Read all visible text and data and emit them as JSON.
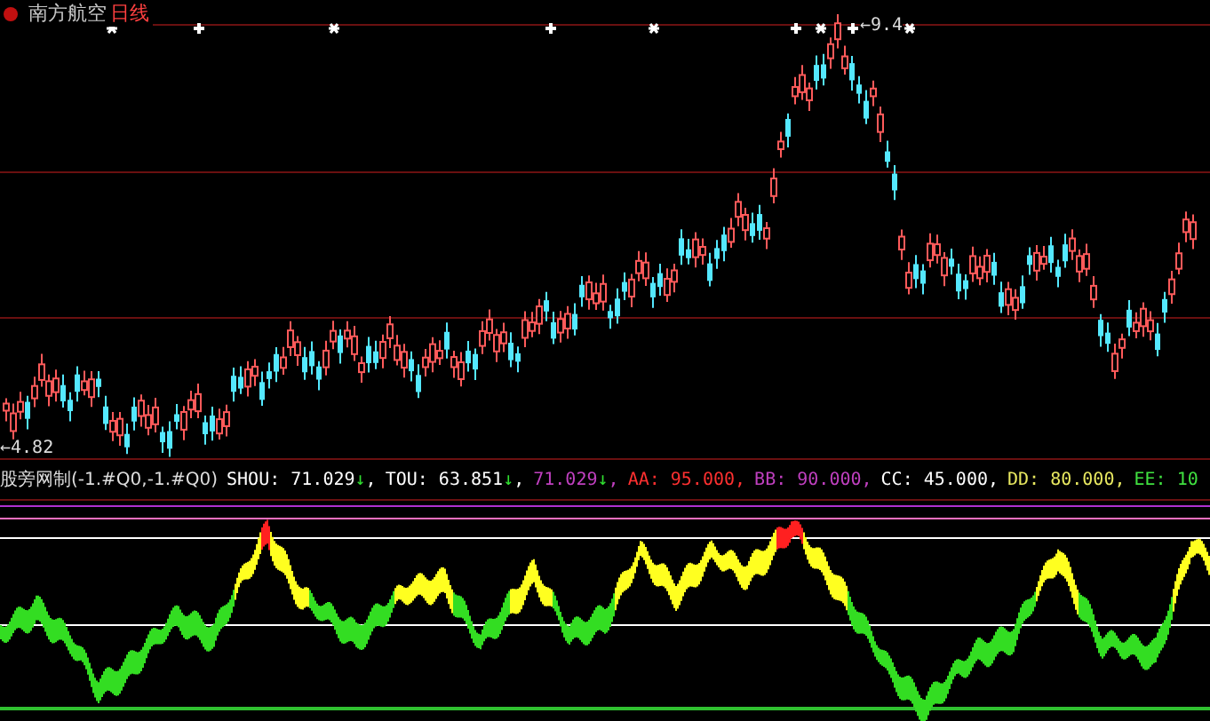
{
  "header": {
    "stock": "南方航空",
    "period": "日线"
  },
  "price_chart": {
    "peak_label": "←9.4",
    "low_label": "←4.82"
  },
  "indicator": {
    "name": "股旁网制(-1.#Q0,-1.#Q0)",
    "items": [
      {
        "text": "SHOU: 71.029",
        "arrow": "↓",
        "suffix": ",",
        "color": "#ffffff"
      },
      {
        "text": "TOU: 63.851",
        "arrow": "↓",
        "suffix": ",",
        "color": "#ffffff"
      },
      {
        "text": "71.029",
        "arrow": "↓",
        "suffix": ",",
        "color": "#c040c0"
      },
      {
        "text": "AA: 95.000,",
        "color": "#ff3030"
      },
      {
        "text": "BB: 90.000,",
        "color": "#c040c0"
      },
      {
        "text": "CC: 45.000,",
        "color": "#ffffff"
      },
      {
        "text": "DD: 80.000,",
        "color": "#e8e860"
      },
      {
        "text": "EE: 10",
        "color": "#40e040"
      }
    ]
  }
}
